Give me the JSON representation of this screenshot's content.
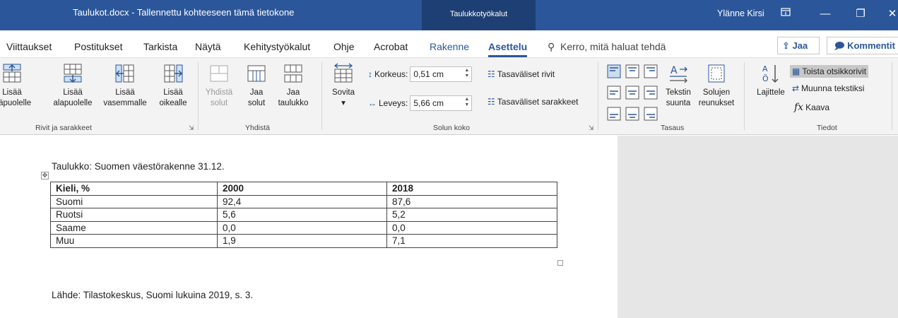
{
  "titlebar": {
    "doc_title": "Taulukot.docx  -  Tallennettu kohteeseen tämä tietokone",
    "context_tab": "Taulukkotyökalut",
    "user": "Ylänne Kirsi",
    "ribbon_display_icon": "ribbon-display-options-icon",
    "minimize_glyph": "—",
    "restore_glyph": "❐",
    "close_glyph": "✕",
    "bg_color": "#2b579a"
  },
  "tabs": [
    {
      "label": "Viittaukset"
    },
    {
      "label": "Postitukset"
    },
    {
      "label": "Tarkista"
    },
    {
      "label": "Näytä"
    },
    {
      "label": "Kehitystyökalut"
    },
    {
      "label": "Ohje"
    },
    {
      "label": "Acrobat"
    },
    {
      "label": "Rakenne"
    },
    {
      "label": "Asettelu"
    }
  ],
  "tellme": "Kerro, mitä haluat tehdä",
  "share_label": "Jaa",
  "comments_label": "Kommentit",
  "ribbon": {
    "rows_cols": {
      "label": "Rivit ja sarakkeet",
      "above": [
        "Lisää",
        "yläpuolelle"
      ],
      "below": [
        "Lisää",
        "alapuolelle"
      ],
      "left": [
        "Lisää",
        "vasemmalle"
      ],
      "right": [
        "Lisää",
        "oikealle"
      ]
    },
    "merge": {
      "label": "Yhdistä",
      "merge_cells": [
        "Yhdistä",
        "solut"
      ],
      "split_cells": [
        "Jaa",
        "solut"
      ],
      "split_table": [
        "Jaa",
        "taulukko"
      ]
    },
    "cell_size": {
      "label": "Solun koko",
      "autofit": "Sovita",
      "height_label": "Korkeus:",
      "height_value": "0,51 cm",
      "width_label": "Leveys:",
      "width_value": "5,66 cm",
      "distribute_rows": "Tasaväliset rivit",
      "distribute_cols": "Tasaväliset sarakkeet"
    },
    "alignment": {
      "label": "Tasaus",
      "text_direction": [
        "Tekstin",
        "suunta"
      ],
      "cell_margins": [
        "Solujen",
        "reunukset"
      ]
    },
    "data": {
      "label": "Tiedot",
      "sort": "Lajittele",
      "repeat_header": "Toista otsikkorivit",
      "convert_text": "Muunna tekstiksi",
      "formula": "Kaava"
    }
  },
  "document": {
    "caption": "Taulukko: Suomen väestörakenne 31.12.",
    "table": {
      "headers": [
        "Kieli, %",
        "2000",
        "2018"
      ],
      "rows": [
        [
          "Suomi",
          "92,4",
          "87,6"
        ],
        [
          "Ruotsi",
          "5,6",
          "5,2"
        ],
        [
          "Saame",
          "0,0",
          "0,0"
        ],
        [
          "Muu",
          "1,9",
          "7,1"
        ]
      ]
    },
    "source": "Lähde: Tilastokeskus, Suomi lukuina 2019, s. 3."
  }
}
